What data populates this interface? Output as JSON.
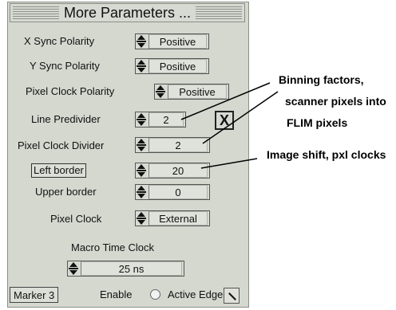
{
  "title": "More Parameters ...",
  "rows": {
    "x_sync": {
      "label": "X Sync Polarity",
      "value": "Positive"
    },
    "y_sync": {
      "label": "Y Sync Polarity",
      "value": "Positive"
    },
    "pixel_clock_polarity": {
      "label": "Pixel Clock Polarity",
      "value": "Positive"
    },
    "line_predivider": {
      "label": "Line Predivider",
      "value": "2"
    },
    "pixel_clock_divider": {
      "label": "Pixel Clock Divider",
      "value": "2"
    },
    "left_border": {
      "label": "Left border",
      "value": "20"
    },
    "upper_border": {
      "label": "Upper border",
      "value": "0"
    },
    "pixel_clock": {
      "label": "Pixel Clock",
      "value": "External"
    }
  },
  "macro_time_clock": {
    "label": "Macro Time Clock",
    "value": "25 ns"
  },
  "close_button": {
    "label": "X"
  },
  "bottom": {
    "marker": "Marker 3",
    "enable": "Enable",
    "active_edge": "Active Edge"
  },
  "annotations": {
    "binning_line1": "Binning factors,",
    "binning_line2": "scanner pixels into",
    "binning_line3": "FLIM pixels",
    "image_shift": "Image shift, pxl clocks"
  }
}
